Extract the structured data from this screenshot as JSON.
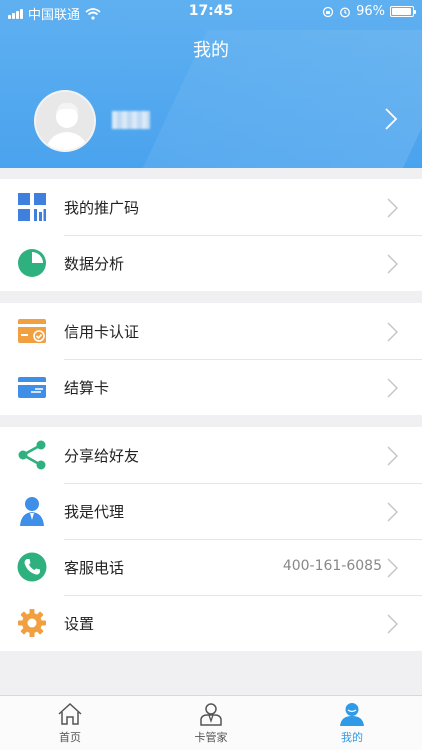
{
  "status_bar": {
    "carrier": "中国联通",
    "time": "17:45",
    "battery": "96%",
    "battery_level": 0.96
  },
  "header": {
    "title": "我的",
    "username": "■■"
  },
  "menu_groups": [
    {
      "items": [
        {
          "label": "我的推广码",
          "icon": "qr-code-icon"
        },
        {
          "label": "数据分析",
          "icon": "pie-chart-icon"
        }
      ]
    },
    {
      "items": [
        {
          "label": "信用卡认证",
          "icon": "credit-card-verify-icon"
        },
        {
          "label": "结算卡",
          "icon": "bank-card-icon"
        }
      ]
    },
    {
      "items": [
        {
          "label": "分享给好友",
          "icon": "share-icon"
        },
        {
          "label": "我是代理",
          "icon": "agent-person-icon"
        },
        {
          "label": "客服电话",
          "icon": "phone-icon",
          "value": "400-161-6085"
        },
        {
          "label": "设置",
          "icon": "gear-icon"
        }
      ]
    }
  ],
  "tabbar": {
    "tabs": [
      {
        "label": "首页",
        "icon": "home-icon",
        "active": false
      },
      {
        "label": "卡管家",
        "icon": "card-manager-icon",
        "active": false
      },
      {
        "label": "我的",
        "icon": "profile-icon",
        "active": true
      }
    ]
  },
  "colors": {
    "header_blue": "#4aa3ee",
    "active_tab": "#2f9ae8",
    "green": "#2fb07f",
    "orange": "#f0a040",
    "blue_icon": "#3f8ee8"
  }
}
